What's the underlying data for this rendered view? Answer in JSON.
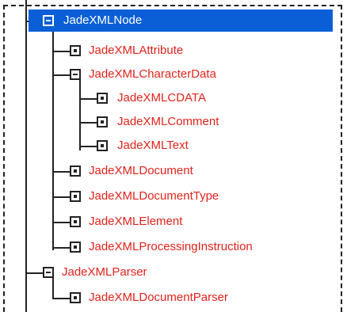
{
  "tree": {
    "nodes": [
      {
        "label": "JadeXMLNode",
        "state": "expanded",
        "selected": true
      },
      {
        "label": "JadeXMLAttribute",
        "state": "leaf"
      },
      {
        "label": "JadeXMLCharacterData",
        "state": "expanded"
      },
      {
        "label": "JadeXMLCDATA",
        "state": "leaf"
      },
      {
        "label": "JadeXMLComment",
        "state": "leaf"
      },
      {
        "label": "JadeXMLText",
        "state": "leaf"
      },
      {
        "label": "JadeXMLDocument",
        "state": "leaf"
      },
      {
        "label": "JadeXMLDocumentType",
        "state": "leaf"
      },
      {
        "label": "JadeXMLElement",
        "state": "leaf"
      },
      {
        "label": "JadeXMLProcessingInstruction",
        "state": "leaf"
      },
      {
        "label": "JadeXMLParser",
        "state": "expanded"
      },
      {
        "label": "JadeXMLDocumentParser",
        "state": "leaf"
      }
    ]
  },
  "colors": {
    "class_label": "#e0231b",
    "selection": "#0a5fd6",
    "tree_lines": "#222222"
  }
}
